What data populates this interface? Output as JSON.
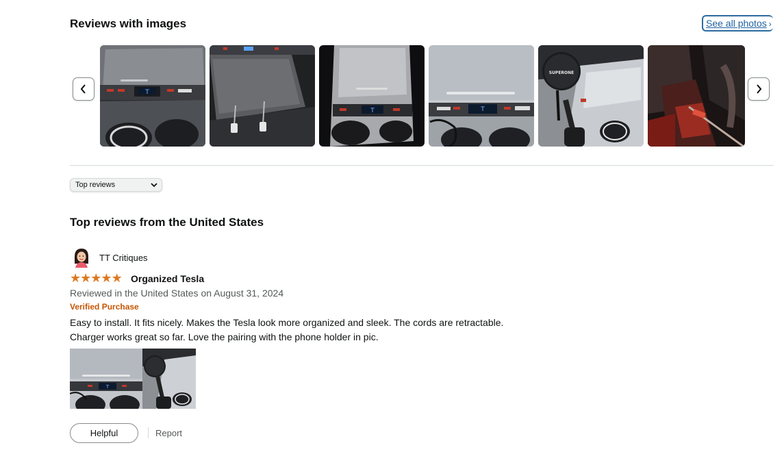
{
  "images_section": {
    "title": "Reviews with images",
    "see_all_label": "See all photos",
    "prev_icon": "chevron-left-icon",
    "next_icon": "chevron-right-icon"
  },
  "sort": {
    "selected": "Top reviews"
  },
  "top_reviews": {
    "title": "Top reviews from the United States"
  },
  "review": {
    "reviewer": "TT Critiques",
    "rating": 5,
    "title": "Organized Tesla",
    "date_line": "Reviewed in the United States on August 31, 2024",
    "verified_label": "Verified Purchase",
    "body_line1": "Easy to install. It fits nicely. Makes the Tesla look more organized and sleek. The cords are retractable.",
    "body_line2": "Charger works great so far. Love the pairing with the phone holder in pic.",
    "helpful_label": "Helpful",
    "report_label": "Report"
  },
  "photo_texts": {
    "charger_brand": "SUPERONE"
  },
  "colors": {
    "star": "#de7921",
    "verified": "#c45500",
    "link": "#2162a1"
  }
}
